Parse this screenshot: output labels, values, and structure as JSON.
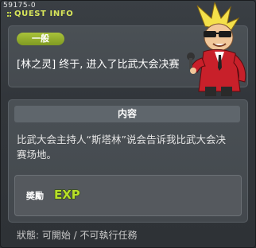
{
  "header": {
    "quest_id": "59175-0",
    "title": "QUEST INFO"
  },
  "summary": {
    "category": "一般",
    "quest_title": "[林之灵] 终于, 进入了比武大会决赛"
  },
  "details": {
    "section_title": "内容",
    "description_line1": "比武大会主持人“斯塔林”说会告诉我比武大会决",
    "description_line2": "赛场地。",
    "reward_label": "奬勵",
    "reward_icon": "exp-icon",
    "reward_text": "EXP"
  },
  "status": {
    "text": "狀態: 可開始 / 不可執行任務"
  },
  "colors": {
    "title_accent": "#d8e65a",
    "category_tag": "#8fae2a",
    "exp_green": "#b8e02a"
  }
}
